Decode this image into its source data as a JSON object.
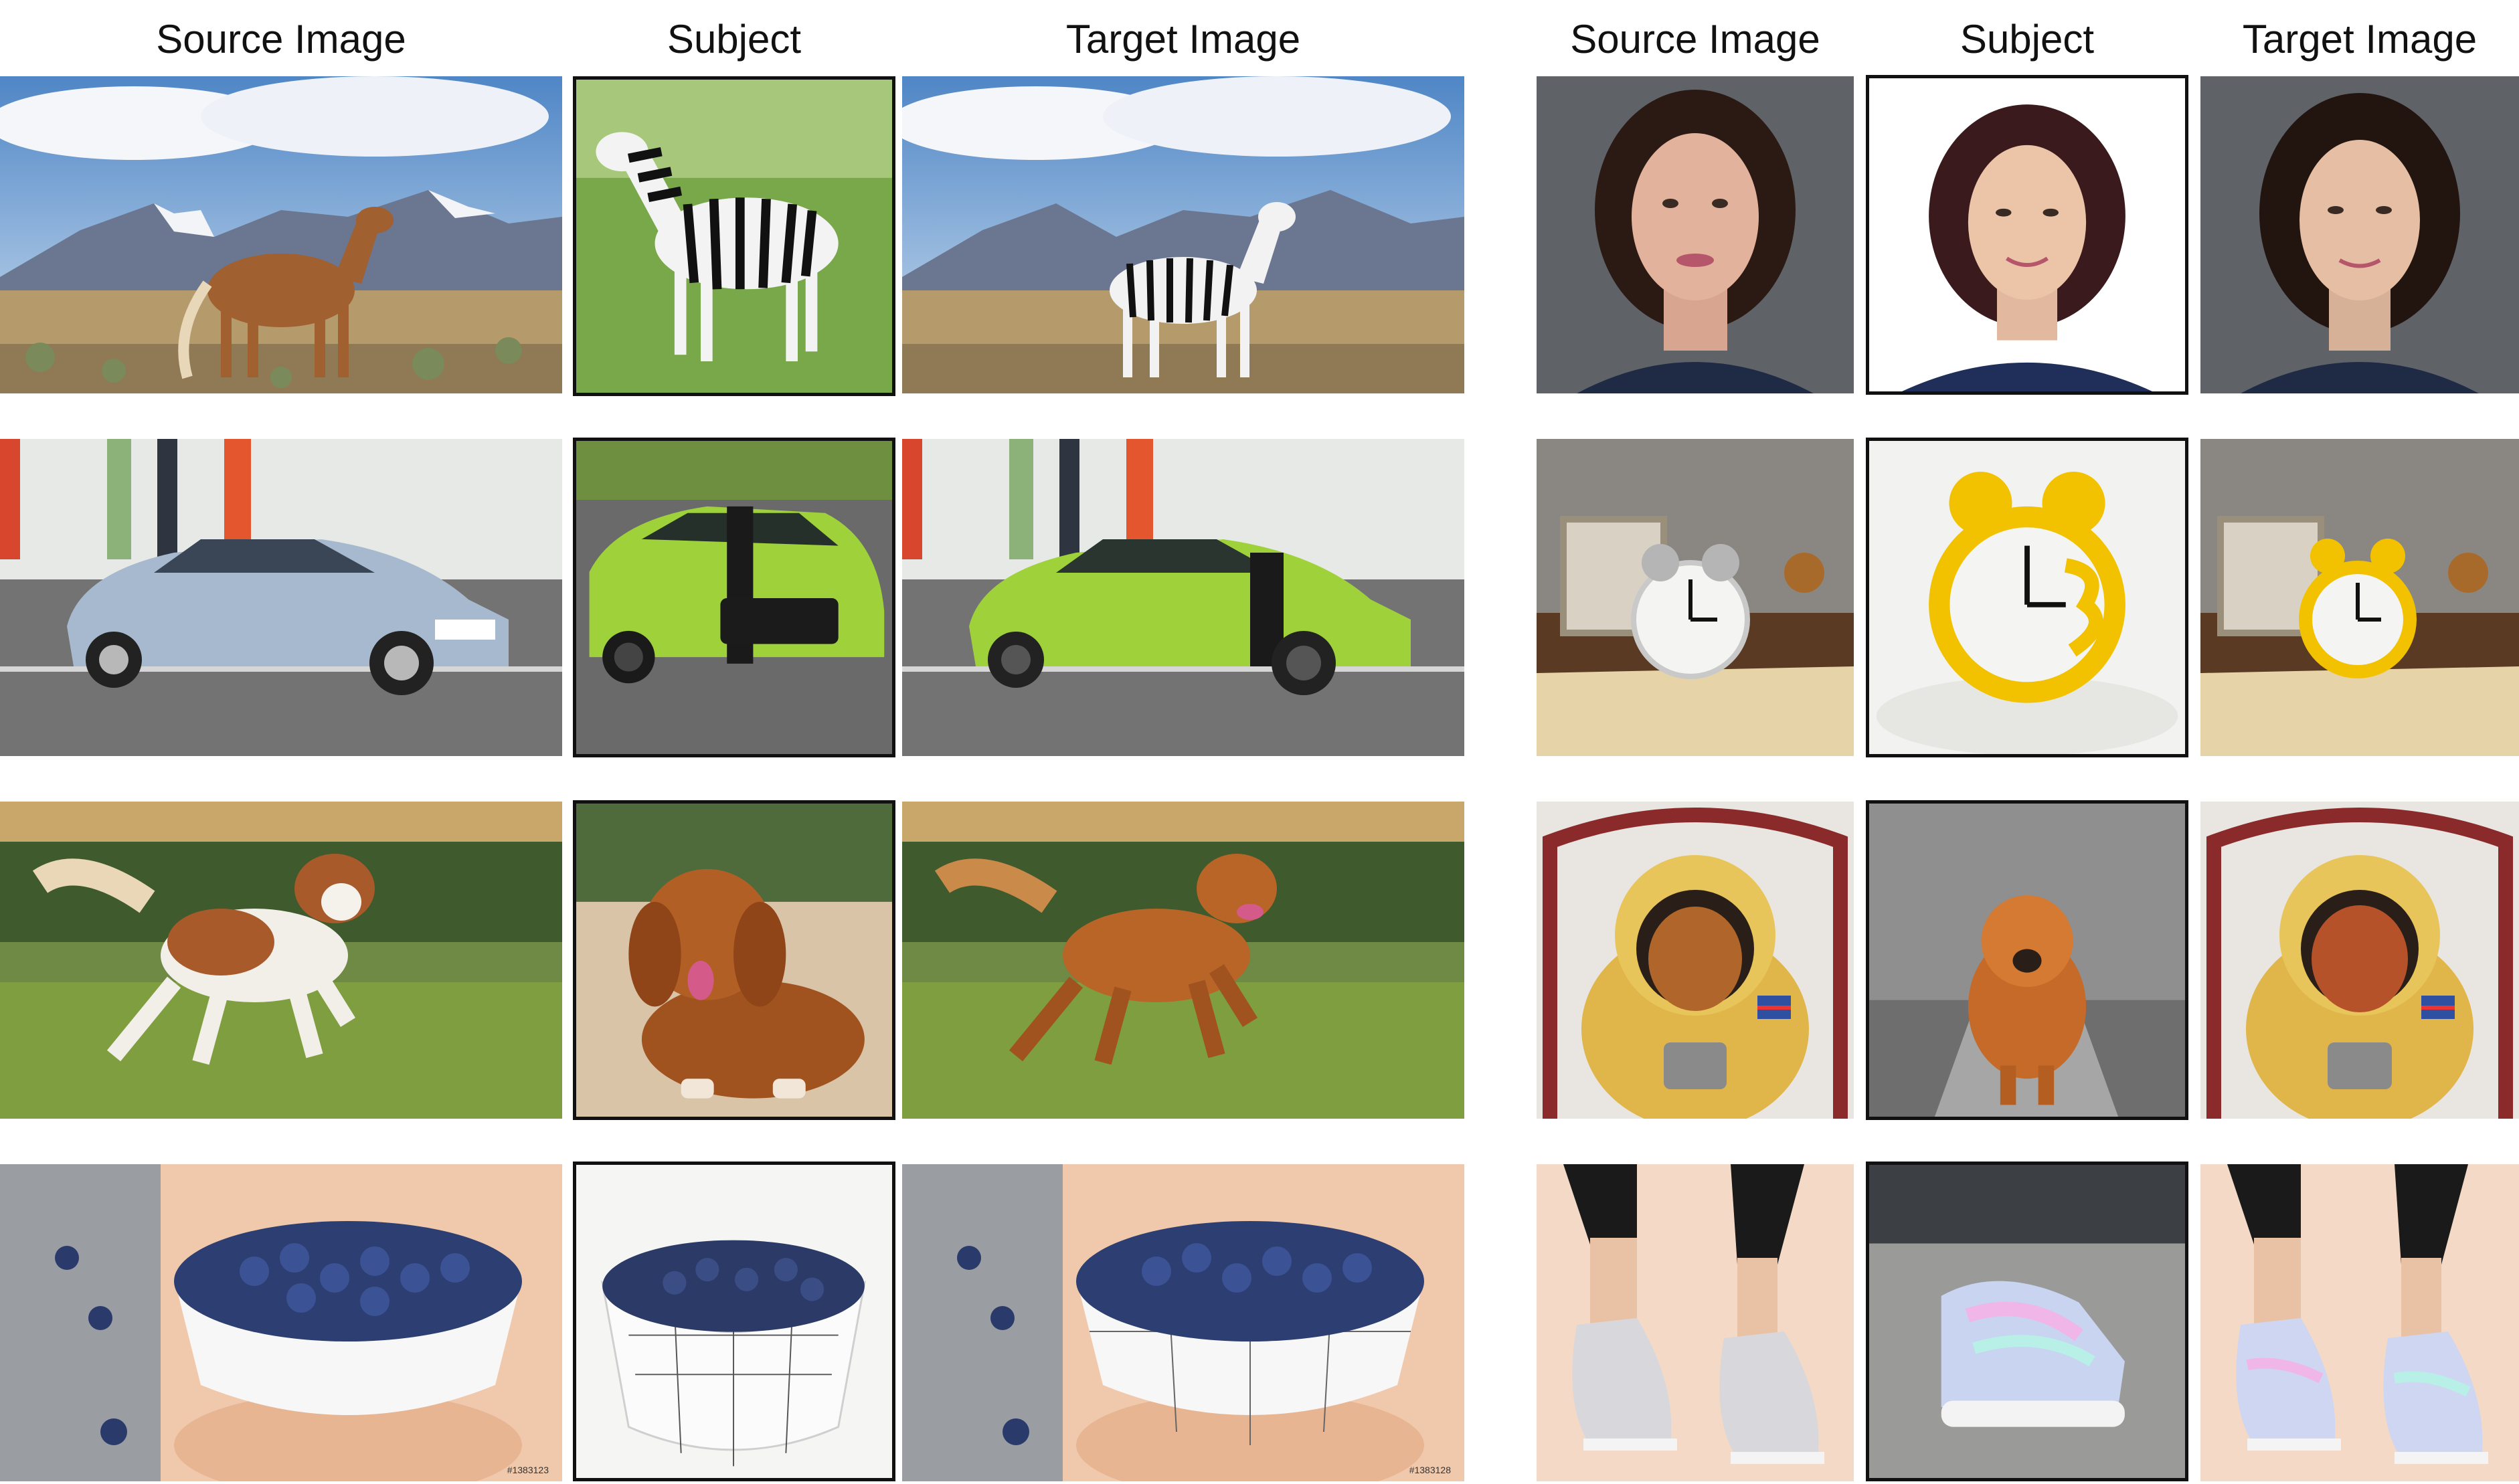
{
  "headers": {
    "left": {
      "source": "Source Image",
      "subject": "Subject",
      "target": "Target Image"
    },
    "right": {
      "source": "Source Image",
      "subject": "Subject",
      "target": "Target Image"
    }
  },
  "left_rows": [
    {
      "source": {
        "theme": "horse",
        "desc": "brown horse in mountain meadow"
      },
      "subject": {
        "theme": "zebra",
        "desc": "zebra on grass"
      },
      "target": {
        "theme": "zebra-meadow",
        "desc": "zebra in mountain meadow"
      }
    },
    {
      "source": {
        "theme": "blue-car",
        "desc": "silver-blue sedan on road"
      },
      "subject": {
        "theme": "green-car",
        "desc": "lime green sports car"
      },
      "target": {
        "theme": "green-car-road",
        "desc": "lime green sports car on road"
      }
    },
    {
      "source": {
        "theme": "dog-run",
        "desc": "white-brown dog running on grass"
      },
      "subject": {
        "theme": "dog-sit",
        "desc": "red-brown dog lying on sand"
      },
      "target": {
        "theme": "dog-run-brown",
        "desc": "red-brown dog running on grass"
      }
    },
    {
      "source": {
        "theme": "blueberries",
        "desc": "white bowl of blueberries held in hand",
        "watermark": "#1383123"
      },
      "subject": {
        "theme": "blueberry-bowl",
        "desc": "grid pattern bowl of blueberries"
      },
      "target": {
        "theme": "blueberries-grid",
        "desc": "grid pattern bowl of blueberries held in hand",
        "watermark": "#1383128"
      }
    }
  ],
  "right_rows": [
    {
      "source": {
        "theme": "woman-portrait",
        "desc": "young woman with dark wavy hair"
      },
      "subject": {
        "theme": "woman-subject",
        "desc": "woman with shoulder-length dark red hair"
      },
      "target": {
        "theme": "woman-target",
        "desc": "woman portrait on grey background"
      }
    },
    {
      "source": {
        "theme": "clock-desk",
        "desc": "silver alarm clock on wooden desk"
      },
      "subject": {
        "theme": "yellow-clock",
        "desc": "yellow alarm clock on white fabric"
      },
      "target": {
        "theme": "yellow-clock-desk",
        "desc": "yellow alarm clock on wooden desk"
      }
    },
    {
      "source": {
        "theme": "astro-dog",
        "desc": "dog in yellow astronaut suit"
      },
      "subject": {
        "theme": "chow",
        "desc": "chow chow walking on forest path"
      },
      "target": {
        "theme": "astro-chow",
        "desc": "chow chow in yellow astronaut suit"
      }
    },
    {
      "source": {
        "theme": "sneakers-silver",
        "desc": "silver sneakers on feet"
      },
      "subject": {
        "theme": "sneaker-holo",
        "desc": "holographic sneaker on pavement"
      },
      "target": {
        "theme": "sneakers-holo",
        "desc": "holographic sneakers on feet"
      }
    }
  ]
}
